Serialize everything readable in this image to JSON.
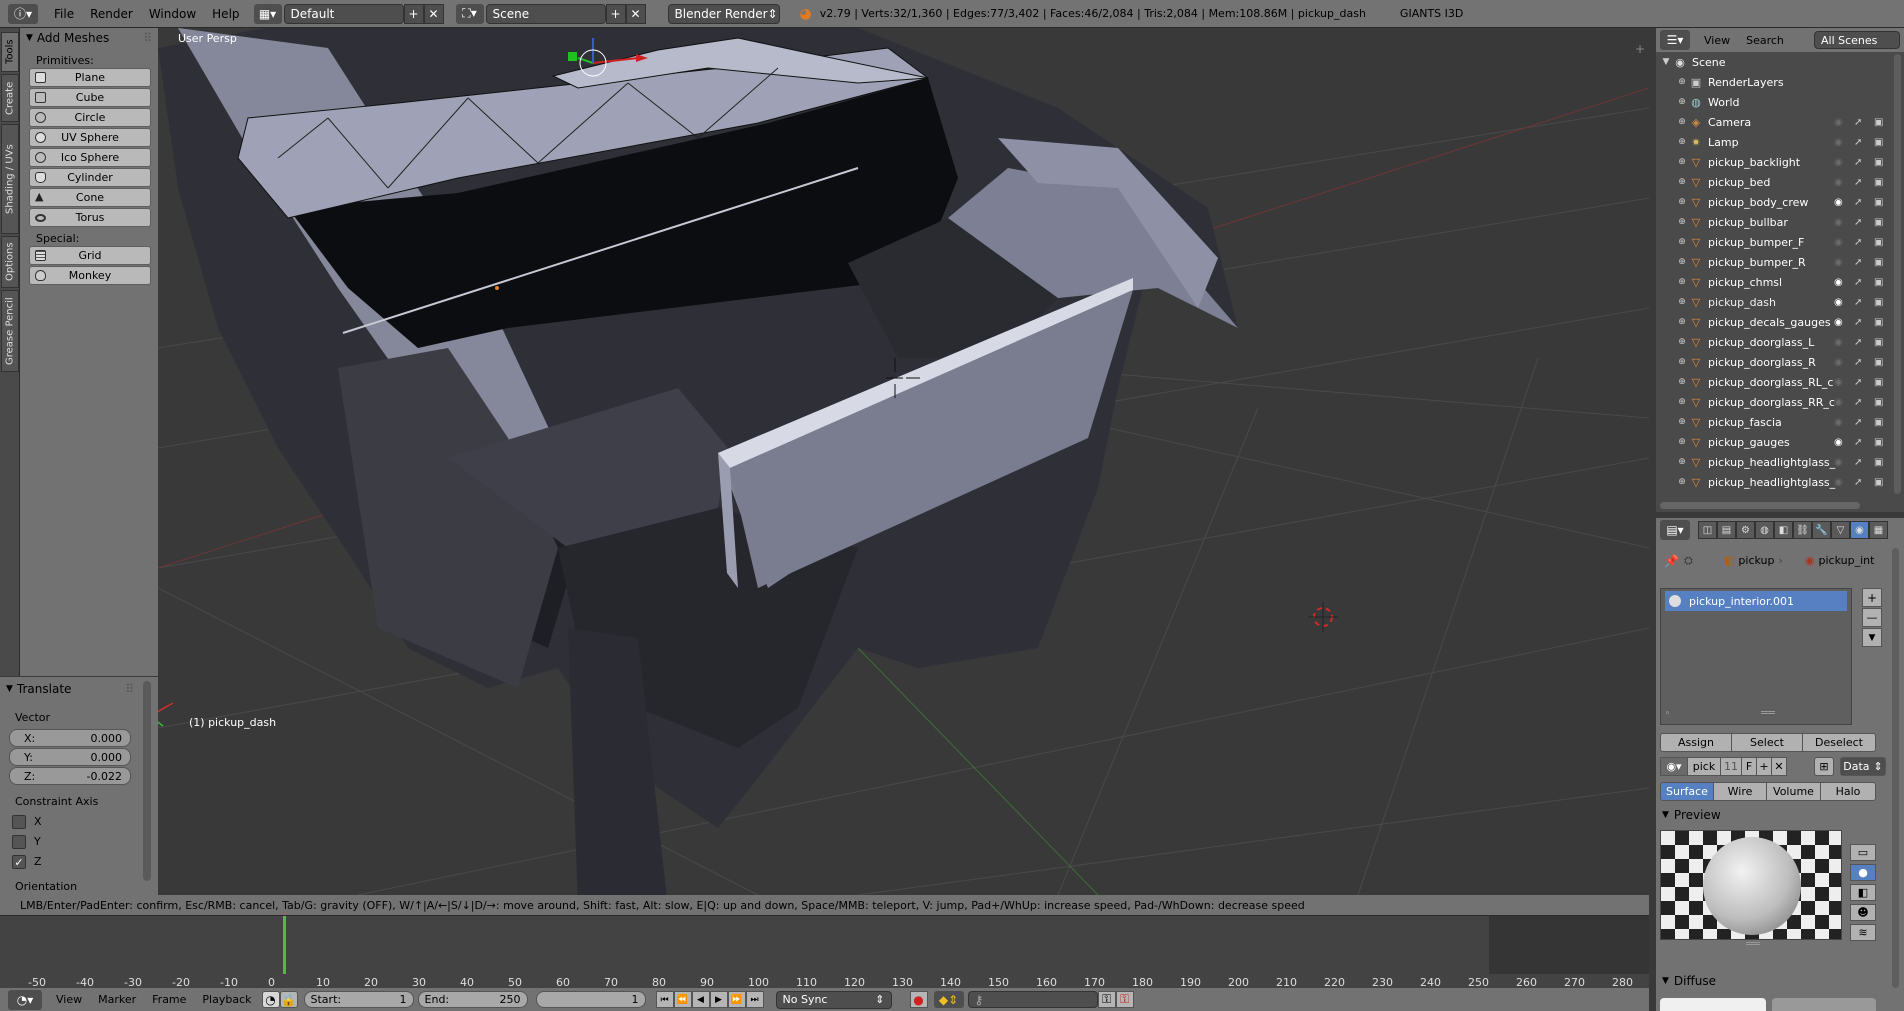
{
  "header": {
    "menus": [
      "File",
      "Render",
      "Window",
      "Help"
    ],
    "layout": "Default",
    "scene": "Scene",
    "engine": "Blender Render",
    "stats": "v2.79 | Verts:32/1,360 | Edges:77/3,402 | Faces:46/2,084 | Tris:2,084 | Mem:108.86M | pickup_dash",
    "addon": "GIANTS I3D"
  },
  "toolshelf": {
    "tabs": [
      "Tools",
      "Create",
      "Shading / UVs",
      "Options",
      "Grease Pencil"
    ],
    "panel_title": "Add Meshes",
    "primitives_label": "Primitives:",
    "primitives": [
      "Plane",
      "Cube",
      "Circle",
      "UV Sphere",
      "Ico Sphere",
      "Cylinder",
      "Cone",
      "Torus"
    ],
    "special_label": "Special:",
    "special": [
      "Grid",
      "Monkey"
    ]
  },
  "redo": {
    "title": "Translate",
    "vector_label": "Vector",
    "x_label": "X:",
    "x": "0.000",
    "y_label": "Y:",
    "y": "0.000",
    "z_label": "Z:",
    "z": "-0.022",
    "constraint_label": "Constraint Axis",
    "axes": [
      "X",
      "Y",
      "Z"
    ],
    "orientation_label": "Orientation"
  },
  "viewport": {
    "view_name": "User Persp",
    "object_name": "(1) pickup_dash"
  },
  "status_hint": "LMB/Enter/PadEnter: confirm, Esc/RMB: cancel, Tab/G: gravity (OFF), W/↑|A/←|S/↓|D/→: move around, Shift: fast, Alt: slow, E|Q: up and down, Space/MMB: teleport, V: jump, Pad+/WhUp: increase speed, Pad-/WhDown: decrease speed",
  "timeline": {
    "ticks": [
      "-50",
      "-40",
      "-30",
      "-20",
      "-10",
      "0",
      "10",
      "20",
      "30",
      "40",
      "50",
      "60",
      "70",
      "80",
      "90",
      "100",
      "110",
      "120",
      "130",
      "140",
      "150",
      "160",
      "170",
      "180",
      "190",
      "200",
      "210",
      "220",
      "230",
      "240",
      "250",
      "260",
      "270",
      "280"
    ],
    "menus": [
      "View",
      "Marker",
      "Frame",
      "Playback"
    ],
    "start_label": "Start:",
    "start": "1",
    "end_label": "End:",
    "end": "250",
    "current": "1",
    "sync": "No Sync"
  },
  "outliner": {
    "menus": [
      "View",
      "Search"
    ],
    "filter": "All Scenes",
    "items": [
      "Scene",
      "RenderLayers",
      "World",
      "Camera",
      "Lamp",
      "pickup_backlight",
      "pickup_bed",
      "pickup_body_crew",
      "pickup_bullbar",
      "pickup_bumper_F",
      "pickup_bumper_R",
      "pickup_chmsl",
      "pickup_dash",
      "pickup_decals_gauges",
      "pickup_doorglass_L",
      "pickup_doorglass_R",
      "pickup_doorglass_RL_c",
      "pickup_doorglass_RR_c",
      "pickup_fascia",
      "pickup_gauges",
      "pickup_headlightglass_",
      "pickup_headlightglass_"
    ]
  },
  "properties": {
    "breadcrumb": [
      "pickup",
      "pickup_int"
    ],
    "slot": "pickup_interior.001",
    "assign": "Assign",
    "select": "Select",
    "deselect": "Deselect",
    "material_short": "pick",
    "users": "11",
    "fake": "F",
    "link": "Data",
    "types": [
      "Surface",
      "Wire",
      "Volume",
      "Halo"
    ],
    "preview_label": "Preview",
    "diffuse_label": "Diffuse"
  },
  "colors": {
    "accent": "#5680c2",
    "selected_item": "#f0f0f0",
    "frame_marker": "#4fbf3a"
  }
}
